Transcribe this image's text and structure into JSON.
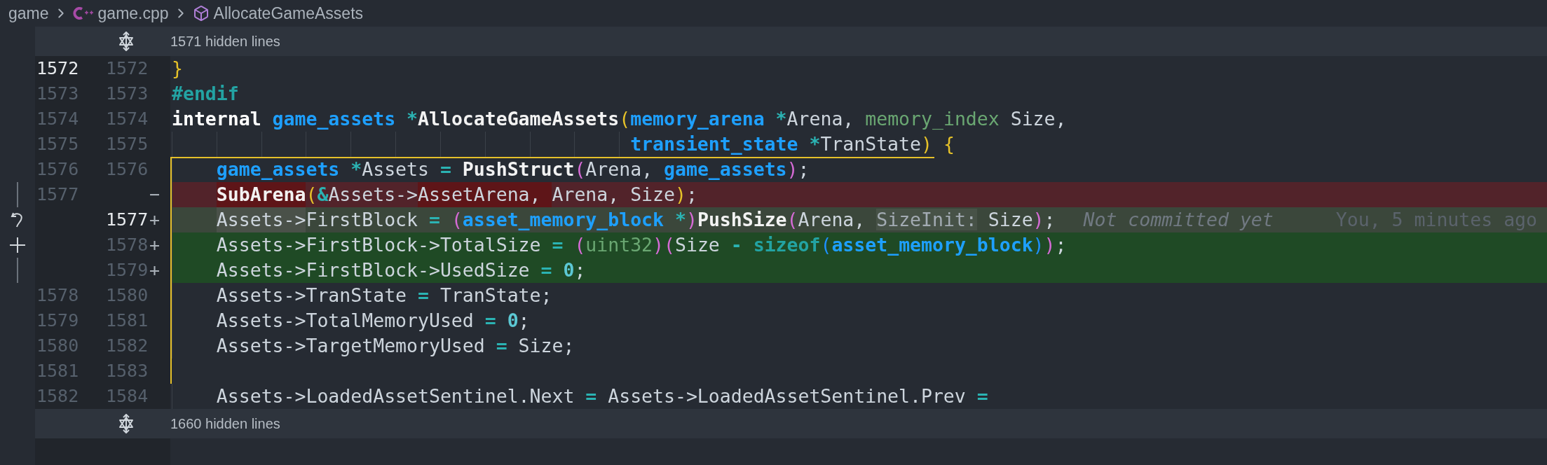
{
  "breadcrumb": [
    {
      "kind": "folder",
      "label": "game"
    },
    {
      "kind": "file",
      "label": "game.cpp"
    },
    {
      "kind": "symbol",
      "label": "AllocateGameAssets"
    }
  ],
  "hidden_above": {
    "label": "1571 hidden lines"
  },
  "lines": [
    {
      "kind": "context",
      "old": "1572",
      "new": "1572",
      "old_current": true,
      "new_current": false,
      "in_scope": false,
      "tokens": [
        {
          "kind": "brace1",
          "text": "}"
        }
      ]
    },
    {
      "kind": "context",
      "old": "1573",
      "new": "1573",
      "old_current": false,
      "new_current": false,
      "in_scope": false,
      "tokens": [
        {
          "kind": "macro",
          "text": "#endif"
        }
      ]
    },
    {
      "kind": "context",
      "old": "1574",
      "new": "1574",
      "old_current": false,
      "new_current": false,
      "in_scope": false,
      "tokens": [
        {
          "kind": "keyword",
          "text": "internal "
        },
        {
          "kind": "type",
          "text": "game_assets "
        },
        {
          "kind": "op",
          "text": "*"
        },
        {
          "kind": "func",
          "text": "AllocateGameAssets"
        },
        {
          "kind": "brace1",
          "text": "("
        },
        {
          "kind": "type",
          "text": "memory_arena "
        },
        {
          "kind": "op",
          "text": "*"
        },
        {
          "kind": "plain",
          "text": "Arena, "
        },
        {
          "kind": "type2",
          "text": "memory_index "
        },
        {
          "kind": "plain",
          "text": "Size,"
        }
      ]
    },
    {
      "kind": "context",
      "indent": {
        "kind": "continuation"
      },
      "old": "1575",
      "new": "1575",
      "old_current": false,
      "new_current": false,
      "in_scope": false,
      "tokens": [
        {
          "kind": "type",
          "text": "transient_state "
        },
        {
          "kind": "op",
          "text": "*"
        },
        {
          "kind": "plain",
          "text": "TranState"
        },
        {
          "kind": "brace1",
          "text": ") {"
        }
      ]
    },
    {
      "kind": "context",
      "indent": {
        "kind": "block"
      },
      "old": "1576",
      "new": "1576",
      "old_current": false,
      "new_current": false,
      "in_scope": true,
      "tokens": [
        {
          "kind": "type",
          "text": "game_assets "
        },
        {
          "kind": "op",
          "text": "*"
        },
        {
          "kind": "plain",
          "text": "Assets "
        },
        {
          "kind": "op",
          "text": "= "
        },
        {
          "kind": "func",
          "text": "PushStruct"
        },
        {
          "kind": "brace2",
          "text": "("
        },
        {
          "kind": "plain",
          "text": "Arena, "
        },
        {
          "kind": "type",
          "text": "game_assets"
        },
        {
          "kind": "brace2",
          "text": ")"
        },
        {
          "kind": "plain",
          "text": ";"
        }
      ]
    },
    {
      "kind": "removed",
      "indent": {
        "kind": "block"
      },
      "old": "1577",
      "marker": "−",
      "gutter_mark": {
        "kind": "bar"
      },
      "old_current": false,
      "in_scope": true,
      "tokens": [
        {
          "kind": "func",
          "text": "SubArena",
          "changed": true
        },
        {
          "kind": "brace1",
          "text": "("
        },
        {
          "kind": "op",
          "text": "&"
        },
        {
          "kind": "plain",
          "text": "Assets->"
        },
        {
          "kind": "plain",
          "text": "AssetArena, ",
          "changed": true
        },
        {
          "kind": "plain",
          "text": "Arena, Size"
        },
        {
          "kind": "brace1",
          "text": ")"
        },
        {
          "kind": "plain",
          "text": ";"
        }
      ]
    },
    {
      "kind": "added",
      "indent": {
        "kind": "block"
      },
      "new": "1577",
      "marker": "+",
      "gutter_mark": {
        "kind": "revert"
      },
      "new_current": true,
      "in_scope": true,
      "blame": {
        "message": "Not committed yet",
        "author": "You, 5 minutes ago"
      },
      "tokens": [
        {
          "kind": "plain",
          "text": "Assets->",
          "changed": true
        },
        {
          "kind": "plain",
          "text": "FirstBlock "
        },
        {
          "kind": "op",
          "text": "= "
        },
        {
          "kind": "brace2",
          "text": "("
        },
        {
          "kind": "type",
          "text": "asset_memory_block "
        },
        {
          "kind": "op",
          "text": "*"
        },
        {
          "kind": "brace2",
          "text": ")"
        },
        {
          "kind": "func",
          "text": "PushSize"
        },
        {
          "kind": "brace2",
          "text": "("
        },
        {
          "kind": "plain",
          "text": "Arena, "
        },
        {
          "kind": "hint",
          "text": "SizeInit:"
        },
        {
          "kind": "plain",
          "text": " Size"
        },
        {
          "kind": "brace2",
          "text": ")"
        },
        {
          "kind": "plain",
          "text": ";"
        }
      ]
    },
    {
      "kind": "added",
      "indent": {
        "kind": "block"
      },
      "new": "1578",
      "marker": "+",
      "gutter_mark": {
        "kind": "stage"
      },
      "new_current": false,
      "in_scope": true,
      "tokens": [
        {
          "kind": "plain",
          "text": "Assets->FirstBlock->TotalSize "
        },
        {
          "kind": "op",
          "text": "= "
        },
        {
          "kind": "brace2",
          "text": "("
        },
        {
          "kind": "type2",
          "text": "uint32"
        },
        {
          "kind": "brace2",
          "text": ")("
        },
        {
          "kind": "plain",
          "text": "Size "
        },
        {
          "kind": "op",
          "text": "- "
        },
        {
          "kind": "macro",
          "text": "sizeof"
        },
        {
          "kind": "brace3",
          "text": "("
        },
        {
          "kind": "type",
          "text": "asset_memory_block"
        },
        {
          "kind": "brace3",
          "text": ")"
        },
        {
          "kind": "brace2",
          "text": ")"
        },
        {
          "kind": "plain",
          "text": ";"
        }
      ]
    },
    {
      "kind": "added",
      "indent": {
        "kind": "block"
      },
      "new": "1579",
      "marker": "+",
      "gutter_mark": {
        "kind": "bar"
      },
      "new_current": false,
      "in_scope": true,
      "tokens": [
        {
          "kind": "plain",
          "text": "Assets->FirstBlock->UsedSize "
        },
        {
          "kind": "op",
          "text": "= "
        },
        {
          "kind": "num",
          "text": "0"
        },
        {
          "kind": "plain",
          "text": ";"
        }
      ]
    },
    {
      "kind": "context",
      "indent": {
        "kind": "block"
      },
      "old": "1578",
      "new": "1580",
      "old_current": false,
      "new_current": false,
      "in_scope": true,
      "tokens": [
        {
          "kind": "plain",
          "text": "Assets->TranState "
        },
        {
          "kind": "op",
          "text": "="
        },
        {
          "kind": "plain",
          "text": " TranState;"
        }
      ]
    },
    {
      "kind": "context",
      "indent": {
        "kind": "block"
      },
      "old": "1579",
      "new": "1581",
      "old_current": false,
      "new_current": false,
      "in_scope": true,
      "tokens": [
        {
          "kind": "plain",
          "text": "Assets->TotalMemoryUsed "
        },
        {
          "kind": "op",
          "text": "= "
        },
        {
          "kind": "num",
          "text": "0"
        },
        {
          "kind": "plain",
          "text": ";"
        }
      ]
    },
    {
      "kind": "context",
      "indent": {
        "kind": "block"
      },
      "old": "1580",
      "new": "1582",
      "old_current": false,
      "new_current": false,
      "in_scope": true,
      "tokens": [
        {
          "kind": "plain",
          "text": "Assets->TargetMemoryUsed "
        },
        {
          "kind": "op",
          "text": "="
        },
        {
          "kind": "plain",
          "text": " Size;"
        }
      ]
    },
    {
      "kind": "context",
      "old": "1581",
      "new": "1583",
      "old_current": false,
      "new_current": false,
      "in_scope": true
    },
    {
      "kind": "context",
      "indent": {
        "kind": "block"
      },
      "old": "1582",
      "new": "1584",
      "old_current": false,
      "new_current": false,
      "in_scope": false,
      "tokens": [
        {
          "kind": "plain",
          "text": "Assets->LoadedAssetSentinel.Next "
        },
        {
          "kind": "op",
          "text": "="
        },
        {
          "kind": "plain",
          "text": " Assets->LoadedAssetSentinel.Prev "
        },
        {
          "kind": "op",
          "text": "="
        }
      ]
    }
  ],
  "hidden_below": {
    "label": "1660 hidden lines"
  }
}
